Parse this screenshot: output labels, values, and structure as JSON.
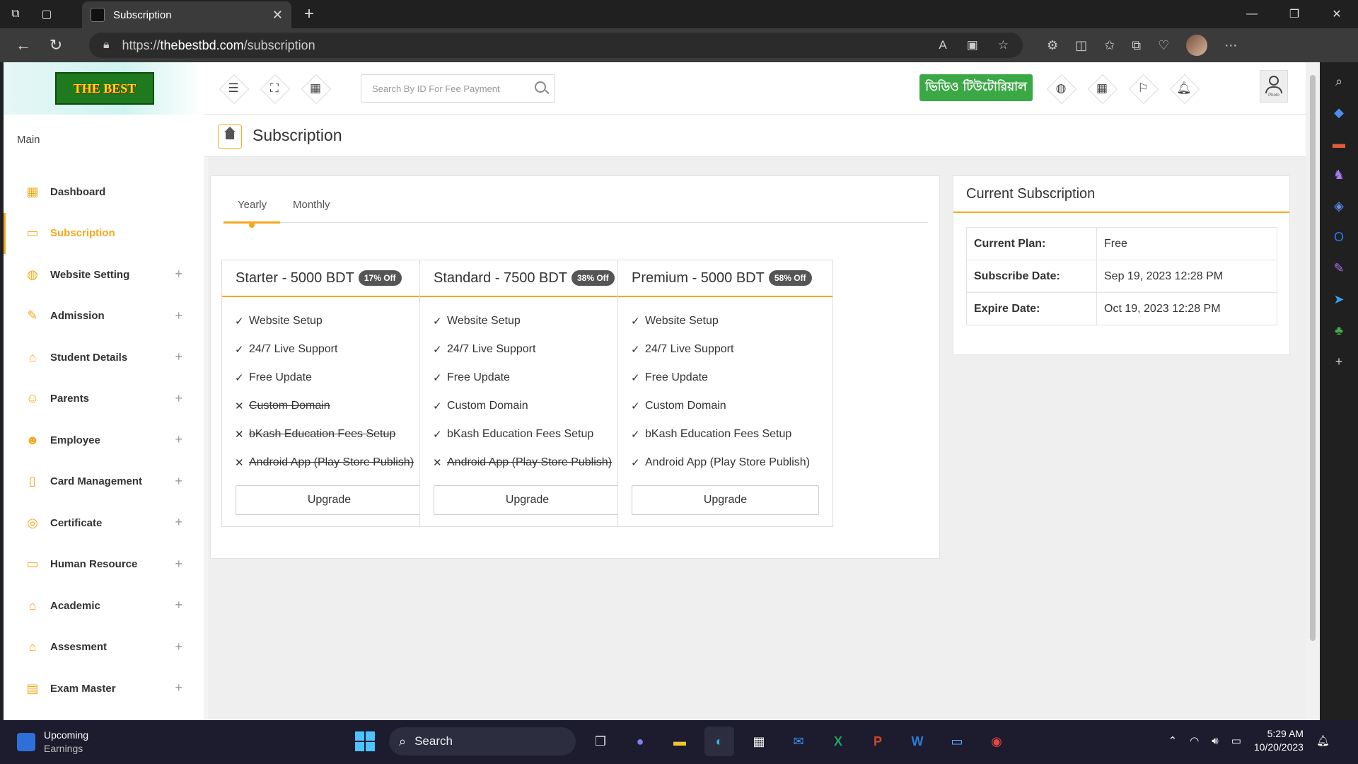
{
  "browser": {
    "tab_title": "Subscription",
    "url_prefix": "https://",
    "url_domain": "thebestbd.com",
    "url_path": "/subscription"
  },
  "header": {
    "logo_text": "THE BEST",
    "search_placeholder": "Search By ID For Fee Payment",
    "tutorial_label": "ভিডিও টিউটোরিয়াল",
    "profile_caption": "Photo"
  },
  "sidebar": {
    "section_label": "Main",
    "items": [
      {
        "label": "Dashboard",
        "icon": "▦",
        "expandable": false,
        "active": false
      },
      {
        "label": "Subscription",
        "icon": "▭",
        "expandable": false,
        "active": true
      },
      {
        "label": "Website Setting",
        "icon": "◍",
        "expandable": true,
        "active": false
      },
      {
        "label": "Admission",
        "icon": "✎",
        "expandable": true,
        "active": false
      },
      {
        "label": "Student Details",
        "icon": "⌂",
        "expandable": true,
        "active": false
      },
      {
        "label": "Parents",
        "icon": "☺",
        "expandable": true,
        "active": false
      },
      {
        "label": "Employee",
        "icon": "☻",
        "expandable": true,
        "active": false
      },
      {
        "label": "Card Management",
        "icon": "▯",
        "expandable": true,
        "active": false
      },
      {
        "label": "Certificate",
        "icon": "◎",
        "expandable": true,
        "active": false
      },
      {
        "label": "Human Resource",
        "icon": "▭",
        "expandable": true,
        "active": false
      },
      {
        "label": "Academic",
        "icon": "⌂",
        "expandable": true,
        "active": false
      },
      {
        "label": "Assesment",
        "icon": "⌂",
        "expandable": true,
        "active": false
      },
      {
        "label": "Exam Master",
        "icon": "▤",
        "expandable": true,
        "active": false
      }
    ],
    "plus_glyph": "+"
  },
  "page": {
    "title": "Subscription"
  },
  "subscription": {
    "tabs": [
      "Yearly",
      "Monthly"
    ],
    "plans": [
      {
        "name": "Starter - 5000 BDT",
        "badge": "17% Off",
        "features": [
          {
            "text": "Website Setup",
            "included": true
          },
          {
            "text": "24/7 Live Support",
            "included": true
          },
          {
            "text": "Free Update",
            "included": true
          },
          {
            "text": "Custom Domain",
            "included": false
          },
          {
            "text": "bKash Education Fees Setup",
            "included": false
          },
          {
            "text": "Android App (Play Store Publish)",
            "included": false
          }
        ],
        "button": "Upgrade"
      },
      {
        "name": "Standard - 7500 BDT",
        "badge": "38% Off",
        "features": [
          {
            "text": "Website Setup",
            "included": true
          },
          {
            "text": "24/7 Live Support",
            "included": true
          },
          {
            "text": "Free Update",
            "included": true
          },
          {
            "text": "Custom Domain",
            "included": true
          },
          {
            "text": "bKash Education Fees Setup",
            "included": true
          },
          {
            "text": "Android App (Play Store Publish)",
            "included": false
          }
        ],
        "button": "Upgrade"
      },
      {
        "name": "Premium - 5000 BDT",
        "badge": "58% Off",
        "features": [
          {
            "text": "Website Setup",
            "included": true
          },
          {
            "text": "24/7 Live Support",
            "included": true
          },
          {
            "text": "Free Update",
            "included": true
          },
          {
            "text": "Custom Domain",
            "included": true
          },
          {
            "text": "bKash Education Fees Setup",
            "included": true
          },
          {
            "text": "Android App (Play Store Publish)",
            "included": true
          }
        ],
        "button": "Upgrade"
      }
    ]
  },
  "current": {
    "title": "Current Subscription",
    "rows": [
      {
        "key": "Current Plan:",
        "value": "Free"
      },
      {
        "key": "Subscribe Date:",
        "value": "Sep 19, 2023 12:28 PM"
      },
      {
        "key": "Expire Date:",
        "value": "Oct 19, 2023 12:28 PM"
      }
    ]
  },
  "taskbar": {
    "weather_title": "Upcoming",
    "weather_sub": "Earnings",
    "search_label": "Search",
    "time": "5:29 AM",
    "date": "10/20/2023"
  },
  "colors": {
    "accent": "#f7a81b",
    "tutorial_green": "#3aa845"
  }
}
